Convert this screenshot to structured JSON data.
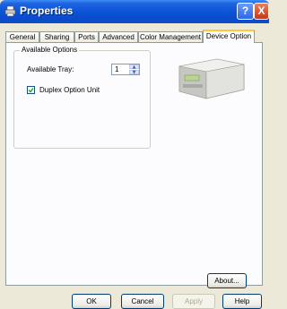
{
  "window": {
    "title": "Properties",
    "help_glyph": "?",
    "close_glyph": "X"
  },
  "tabs": [
    "General",
    "Sharing",
    "Ports",
    "Advanced",
    "Color Management",
    "Device Option"
  ],
  "active_tab": "Device Option",
  "options": {
    "group_title": "Available Options",
    "tray_label": "Available Tray:",
    "tray_value": "1",
    "duplex_label": "Duplex Option Unit",
    "duplex_checked": true
  },
  "buttons": {
    "about": "About...",
    "ok": "OK",
    "cancel": "Cancel",
    "apply": "Apply",
    "help": "Help"
  },
  "colors": {
    "titlebar": "#0a52d6",
    "tab_highlight": "#ffc73c",
    "close": "#c33a16"
  }
}
